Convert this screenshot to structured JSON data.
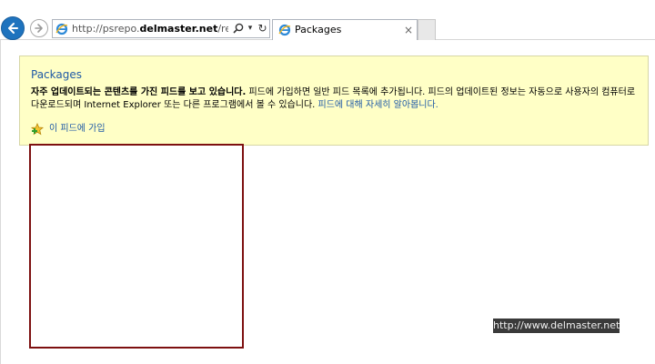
{
  "browser": {
    "address": {
      "prefix": "http://psrepo.",
      "domain": "delmaster.net",
      "path": "/repo/nuget/l"
    },
    "tab": {
      "title": "Packages",
      "close_glyph": "×"
    },
    "icons": {
      "back": "back-arrow-icon",
      "forward": "forward-arrow-icon",
      "site": "ie-logo-icon",
      "search": "magnifier-icon",
      "dropdown": "dropdown-arrow-icon",
      "refresh": "refresh-icon"
    },
    "accent_color": "#1e73be"
  },
  "feed": {
    "title": "Packages",
    "description_bold": "자주 업데이트되는 콘텐츠를 가진 피드를 보고 있습니다.",
    "description_text": " 피드에 가입하면 일반 피드 목록에 추가됩니다. 피드의 업데이트된 정보는 자동으로 사용자의 컴퓨터로 다운로드되며 Internet Explorer 또는 다른 프로그램에서 볼 수 있습니다. ",
    "learn_more_link": "피드에 대해 자세히 알아봅니다.",
    "subscribe_label": "이 피드에 가입",
    "subscribe_icon": "add-favorite-star-icon",
    "banner_color": "#ffffc6",
    "link_color": "#1f5aa6"
  },
  "watermark": "http://www.delmaster.net",
  "highlight_color": "#7d1010"
}
